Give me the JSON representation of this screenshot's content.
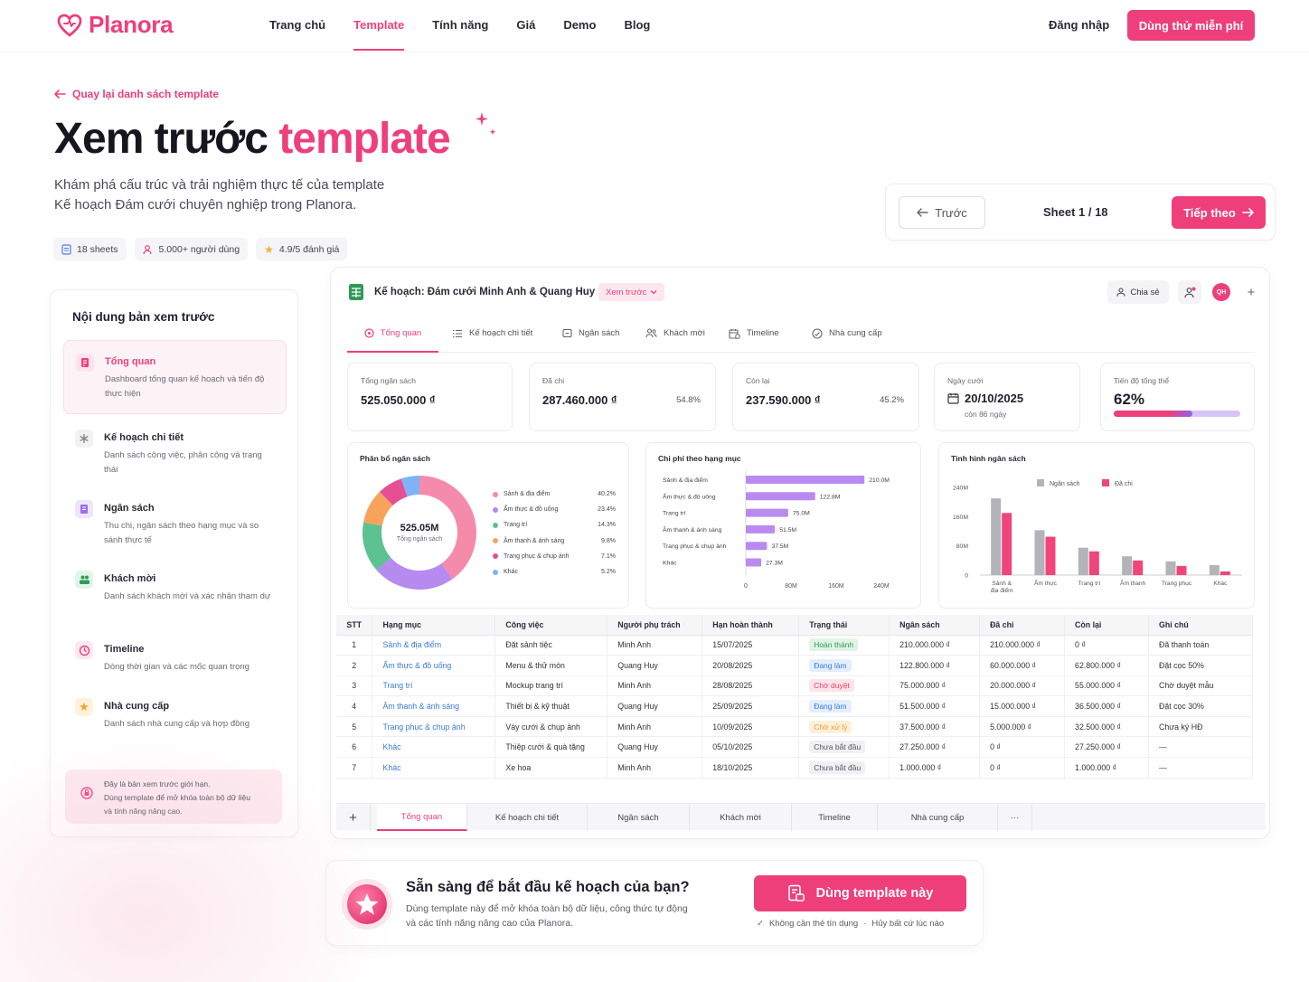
{
  "brand": {
    "name": "Planora",
    "color": "#ee3f7a"
  },
  "nav": {
    "items": [
      {
        "label": "Trang chủ",
        "active": false
      },
      {
        "label": "Template",
        "active": true
      },
      {
        "label": "Tính năng",
        "active": false
      },
      {
        "label": "Giá",
        "active": false
      },
      {
        "label": "Demo",
        "active": false
      },
      {
        "label": "Blog",
        "active": false
      }
    ],
    "login": "Đăng nhập",
    "cta": "Dùng thử miễn phí"
  },
  "hero": {
    "back_link": "Quay lại danh sách template",
    "title_main": "Xem trước",
    "title_accent": "template",
    "subtitle_line1": "Khám phá cấu trúc và trải nghiệm thực tế của template",
    "subtitle_line2": "Kế hoạch Đám cưới chuyên nghiệp trong Planora.",
    "badges": [
      "18 sheets",
      "5.000+ người dùng",
      "4.9/5 đánh giá"
    ]
  },
  "pager": {
    "prev": "Trước",
    "sheet": "Sheet 1 / 18",
    "next": "Tiếp theo"
  },
  "sidebar": {
    "title": "Nội dung bản xem trước",
    "items": [
      {
        "name": "Tổng quan",
        "desc": "Dashboard tổng quan kế hoạch và tiến độ thực hiện",
        "active": true,
        "icon": "dashboard-icon"
      },
      {
        "name": "Kế hoạch chi tiết",
        "desc": "Danh sách công việc, phân công và trạng thái",
        "active": false,
        "icon": "asterisk-icon"
      },
      {
        "name": "Ngân sách",
        "desc": "Thu chi, ngân sách theo hạng mục và so sánh thực tế",
        "active": false,
        "icon": "document-icon"
      },
      {
        "name": "Khách mời",
        "desc": "Danh sách khách mời và xác nhận tham dự",
        "active": false,
        "icon": "guests-icon"
      },
      {
        "name": "Timeline",
        "desc": "Dòng thời gian và các mốc quan trọng",
        "active": false,
        "icon": "clock-icon"
      },
      {
        "name": "Nhà cung cấp",
        "desc": "Danh sách nhà cung cấp và hợp đồng",
        "active": false,
        "icon": "star-icon"
      }
    ],
    "note_line1": "Đây là bản xem trước giới hạn.",
    "note_line2": "Dùng template để mở khóa toàn bộ dữ liệu",
    "note_line3": "và tính năng nâng cao."
  },
  "preview": {
    "doc_title": "Kế hoạch: Đám cưới Minh Anh & Quang Huy",
    "view_mode": "Xem trước",
    "share": "Chia sẻ",
    "avatar": "QH",
    "tabs": [
      "Tổng quan",
      "Kế hoạch chi tiết",
      "Ngân sách",
      "Khách mời",
      "Timeline",
      "Nhà cung cấp"
    ],
    "stats": {
      "total_label": "Tổng ngân sách",
      "total_value": "525.050.000 ₫",
      "spent_label": "Đã chi",
      "spent_value": "287.460.000 ₫",
      "spent_pct": "54.8%",
      "left_label": "Còn lại",
      "left_value": "237.590.000 ₫",
      "left_pct": "45.2%",
      "date_label": "Ngày cưới",
      "date_value": "20/10/2025",
      "date_sub": "còn 86 ngày",
      "progress_label": "Tiến độ tổng thể",
      "progress_value": "62%",
      "progress": 0.62
    },
    "donut": {
      "title": "Phân bổ ngân sách",
      "center_value": "525.05M",
      "center_label": "Tổng ngân sách"
    },
    "bars_title": "Chi phí theo hạng mục",
    "grouped_title": "Tình hình ngân sách",
    "table": {
      "headers": [
        "STT",
        "Hạng mục",
        "Công việc",
        "Người phụ trách",
        "Hạn hoàn thành",
        "Trạng thái",
        "Ngân sách",
        "Đã chi",
        "Còn lại",
        "Ghi chú"
      ],
      "rows": [
        [
          "1",
          "Sảnh & địa điểm",
          "Đặt sảnh tiệc",
          "Minh Anh",
          "15/07/2025",
          "Hoàn thành",
          "210.000.000 ₫",
          "210.000.000 ₫",
          "0 ₫",
          "Đã thanh toán"
        ],
        [
          "2",
          "Ẩm thực & đồ uống",
          "Menu & thử món",
          "Quang Huy",
          "20/08/2025",
          "Đang làm",
          "122.800.000 ₫",
          "60.000.000 ₫",
          "62.800.000 ₫",
          "Đặt cọc 50%"
        ],
        [
          "3",
          "Trang trí",
          "Mockup trang trí",
          "Minh Anh",
          "28/08/2025",
          "Chờ duyệt",
          "75.000.000 ₫",
          "20.000.000 ₫",
          "55.000.000 ₫",
          "Chờ duyệt mẫu"
        ],
        [
          "4",
          "Âm thanh & ánh sáng",
          "Thiết bị & kỹ thuật",
          "Quang Huy",
          "25/09/2025",
          "Đang làm",
          "51.500.000 ₫",
          "15.000.000 ₫",
          "36.500.000 ₫",
          "Đặt cọc 30%"
        ],
        [
          "5",
          "Trang phục & chụp ảnh",
          "Váy cưới & chụp ảnh",
          "Minh Anh",
          "10/09/2025",
          "Chờ xử lý",
          "37.500.000 ₫",
          "5.000.000 ₫",
          "32.500.000 ₫",
          "Chưa ký HĐ"
        ],
        [
          "6",
          "Khác",
          "Thiệp cưới & quà tặng",
          "Quang Huy",
          "05/10/2025",
          "Chưa bắt đầu",
          "27.250.000 ₫",
          "0 ₫",
          "27.250.000 ₫",
          "—"
        ],
        [
          "7",
          "Khác",
          "Xe hoa",
          "Minh Anh",
          "18/10/2025",
          "Chưa bắt đầu",
          "1.000.000 ₫",
          "0 ₫",
          "1.000.000 ₫",
          "—"
        ]
      ],
      "status_colors": {
        "Hoàn thành": {
          "bg": "#dff4e6",
          "fg": "#2f9a55"
        },
        "Đang làm": {
          "bg": "#e3efff",
          "fg": "#3a7bd5"
        },
        "Chờ duyệt": {
          "bg": "#fde3ea",
          "fg": "#e2456f"
        },
        "Chờ xử lý": {
          "bg": "#fff0dc",
          "fg": "#ef9a2a"
        },
        "Chưa bắt đầu": {
          "bg": "#f0f0f3",
          "fg": "#555560"
        }
      }
    },
    "sheet_tabs": [
      "Tổng quan",
      "Kế hoạch chi tiết",
      "Ngân sách",
      "Khách mời",
      "Timeline",
      "Nhà cung cấp",
      "···"
    ]
  },
  "chart_data": [
    {
      "type": "pie",
      "title": "Phân bổ ngân sách",
      "categories": [
        "Sảnh & địa điểm",
        "Ẩm thực & đồ uống",
        "Trang trí",
        "Âm thanh & ánh sáng",
        "Trang phục & chụp ảnh",
        "Khác"
      ],
      "values": [
        40.2,
        23.4,
        14.3,
        9.8,
        7.1,
        5.2
      ],
      "labels": [
        "40.2%",
        "23.4%",
        "14.3%",
        "9.8%",
        "7.1%",
        "5.2%"
      ],
      "colors": [
        "#f58bab",
        "#b78af0",
        "#5cc28f",
        "#f7a35c",
        "#e64f93",
        "#7eb3f5"
      ]
    },
    {
      "type": "bar",
      "title": "Chi phí theo hạng mục",
      "orientation": "horizontal",
      "categories": [
        "Sảnh & địa điểm",
        "Ẩm thực & đồ uống",
        "Trang trí",
        "Âm thanh & ánh sáng",
        "Trang phục & chụp ảnh",
        "Khác"
      ],
      "values": [
        210.0,
        122.8,
        75.0,
        51.5,
        37.5,
        27.3
      ],
      "labels": [
        "210.0M",
        "122.8M",
        "75.0M",
        "51.5M",
        "37.5M",
        "27.3M"
      ],
      "xticks": [
        "0",
        "80M",
        "160M",
        "240M"
      ],
      "xlim": [
        0,
        240
      ],
      "color": "#b98bf0"
    },
    {
      "type": "bar",
      "title": "Tình hình ngân sách",
      "categories": [
        "Sảnh & địa điểm",
        "Ẩm thực",
        "Trang trí",
        "Âm thanh",
        "Trang phục",
        "Khác"
      ],
      "series": [
        {
          "name": "Ngân sách",
          "values": [
            210.0,
            122.8,
            75.0,
            51.5,
            37.5,
            27.3
          ],
          "color": "#b3b3ba"
        },
        {
          "name": "Đã chi",
          "values": [
            170.0,
            105.0,
            65.0,
            40.0,
            25.0,
            10.0
          ],
          "color": "#f0457a"
        }
      ],
      "yticks": [
        "0",
        "80M",
        "160M",
        "240M"
      ],
      "ylim": [
        0,
        240
      ],
      "legend": "top"
    }
  ],
  "cta": {
    "title": "Sẵn sàng để bắt đầu kế hoạch của bạn?",
    "subtitle_line1": "Dùng template này để mở khóa toàn bộ dữ liệu, công thức tự động",
    "subtitle_line2": "và các tính năng nâng cao của Planora.",
    "button": "Dùng template này",
    "note1": "Không cần thẻ tín dụng",
    "note2": "Hủy bất cứ lúc nào"
  }
}
